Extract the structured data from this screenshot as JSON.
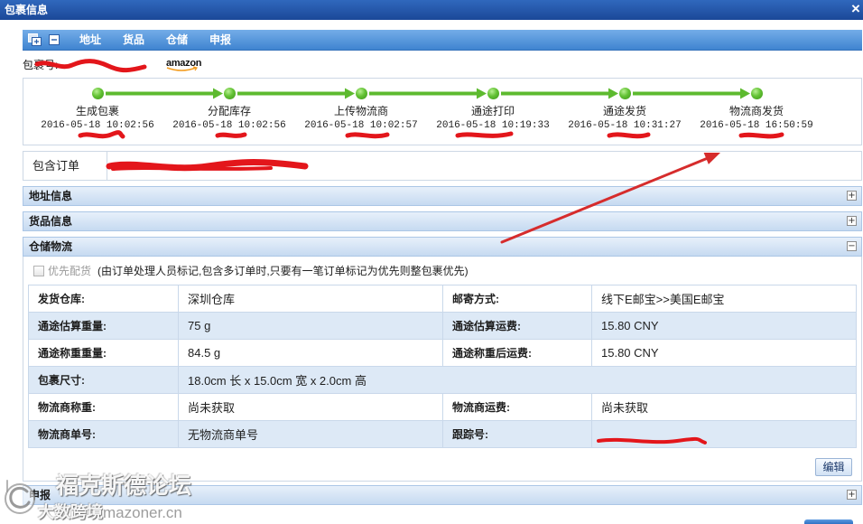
{
  "window": {
    "title": "包裹信息",
    "close": "×"
  },
  "toolbar": {
    "icons": [
      "expand-all-icon",
      "collapse-all-icon"
    ],
    "items": [
      "地址",
      "货品",
      "仓储",
      "申报"
    ]
  },
  "package": {
    "number_label": "包裹号:",
    "platform_logo": "amazon"
  },
  "timeline": {
    "steps": [
      {
        "label": "生成包裹",
        "time": "2016-05-18 10:02:56"
      },
      {
        "label": "分配库存",
        "time": "2016-05-18 10:02:56"
      },
      {
        "label": "上传物流商",
        "time": "2016-05-18 10:02:57"
      },
      {
        "label": "通途打印",
        "time": "2016-05-18 10:19:33"
      },
      {
        "label": "通途发货",
        "time": "2016-05-18 10:31:27"
      },
      {
        "label": "物流商发货",
        "time": "2016-05-18 16:50:59"
      }
    ]
  },
  "orders": {
    "label": "包含订单"
  },
  "sections": {
    "address": {
      "title": "地址信息",
      "toggle": "+",
      "expanded": false
    },
    "goods": {
      "title": "货品信息",
      "toggle": "+",
      "expanded": false
    },
    "logistics": {
      "title": "仓储物流",
      "toggle": "−",
      "expanded": true
    },
    "declare": {
      "title": "申报",
      "toggle": "+",
      "expanded": false
    }
  },
  "logistics": {
    "priority": {
      "label": "优先配货",
      "checked": false,
      "note": "(由订单处理人员标记,包含多订单时,只要有一笔订单标记为优先则整包裹优先)"
    },
    "rows": [
      {
        "label1": "发货仓库:",
        "value1": "深圳仓库",
        "label2": "邮寄方式:",
        "value2": "线下E邮宝>>美国E邮宝"
      },
      {
        "label1": "通途估算重量:",
        "value1": "75 g",
        "label2": "通途估算运费:",
        "value2": "15.80 CNY"
      },
      {
        "label1": "通途称重重量:",
        "value1": "84.5 g",
        "label2": "通途称重后运费:",
        "value2": "15.80 CNY"
      },
      {
        "label1": "包裹尺寸:",
        "value1": "18.0cm 长 x 15.0cm 宽 x 2.0cm 高"
      },
      {
        "label1": "物流商称重:",
        "value1": "尚未获取",
        "label2": "物流商运费:",
        "value2": "尚未获取"
      },
      {
        "label1": "物流商单号:",
        "value1": "无物流商单号",
        "label2": "跟踪号:"
      }
    ],
    "edit_label": "编辑"
  },
  "watermark": {
    "title": "福克斯德论坛",
    "subtitle": "大数跨境",
    "url": "mazoner.cn"
  },
  "colors": {
    "title_bar": "#1f4fa3",
    "toolbar": "#4b8dd5",
    "progress_green": "#5dba2f",
    "annotation_red": "#d62c2c",
    "row_alternate": "#dde9f6"
  }
}
